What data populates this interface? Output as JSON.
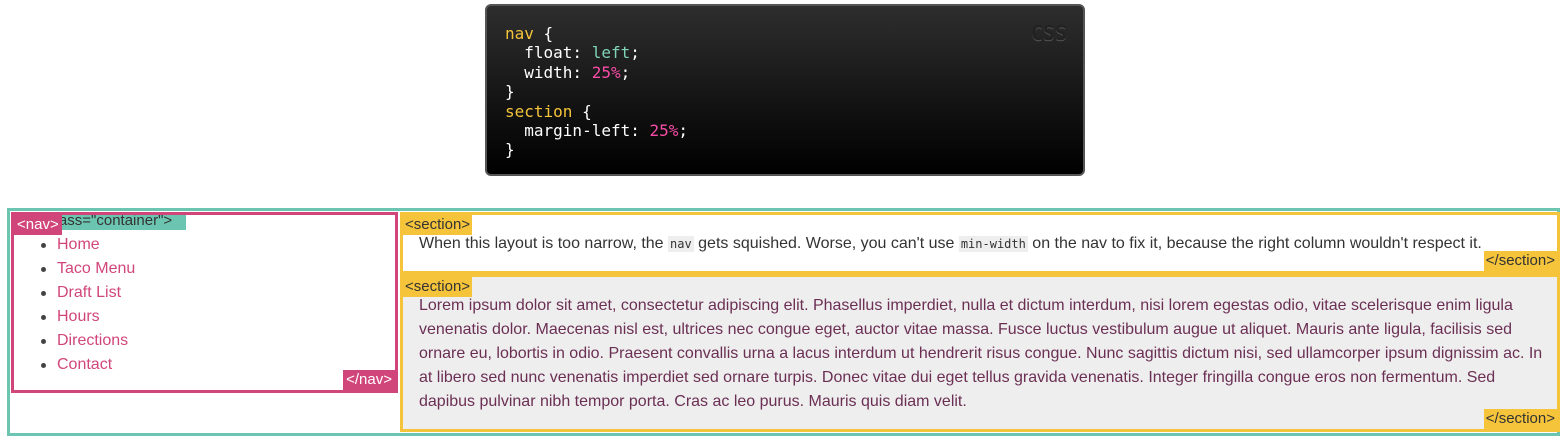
{
  "colors": {
    "container_accent": "#6cc5b0",
    "nav_accent": "#d1467a",
    "section_accent": "#f5c43b",
    "code_background": "#000000"
  },
  "code_block": {
    "language_label": "CSS",
    "lines": [
      {
        "selector": "nav",
        "tail": " {"
      },
      {
        "prop": "  float: ",
        "value": "left",
        "tail": ";"
      },
      {
        "prop": "  width: ",
        "number": "25%",
        "tail": ";"
      },
      {
        "tail": "}"
      },
      {
        "selector": "section",
        "tail": " {"
      },
      {
        "prop": "  margin-left: ",
        "number": "25%",
        "tail": ";"
      },
      {
        "tail": "}"
      }
    ]
  },
  "demo": {
    "container_tag": "<div class=\"container\">",
    "nav": {
      "open_tag": "<nav>",
      "close_tag": "</nav>",
      "items": [
        "Home",
        "Taco Menu",
        "Draft List",
        "Hours",
        "Directions",
        "Contact"
      ]
    },
    "sections": [
      {
        "open_tag": "<section>",
        "close_tag": "</section>",
        "text_before": "When this layout is too narrow, the ",
        "code_1": "nav",
        "text_middle": " gets squished. Worse, you can't use ",
        "code_2": "min-width",
        "text_after": " on the nav to fix it, because the right column wouldn't respect it."
      },
      {
        "open_tag": "<section>",
        "close_tag": "</section>",
        "text": "Lorem ipsum dolor sit amet, consectetur adipiscing elit. Phasellus imperdiet, nulla et dictum interdum, nisi lorem egestas odio, vitae scelerisque enim ligula venenatis dolor. Maecenas nisl est, ultrices nec congue eget, auctor vitae massa. Fusce luctus vestibulum augue ut aliquet. Mauris ante ligula, facilisis sed ornare eu, lobortis in odio. Praesent convallis urna a lacus interdum ut hendrerit risus congue. Nunc sagittis dictum nisi, sed ullamcorper ipsum dignissim ac. In at libero sed nunc venenatis imperdiet sed ornare turpis. Donec vitae dui eget tellus gravida venenatis. Integer fringilla congue eros non fermentum. Sed dapibus pulvinar nibh tempor porta. Cras ac leo purus. Mauris quis diam velit."
      }
    ]
  }
}
